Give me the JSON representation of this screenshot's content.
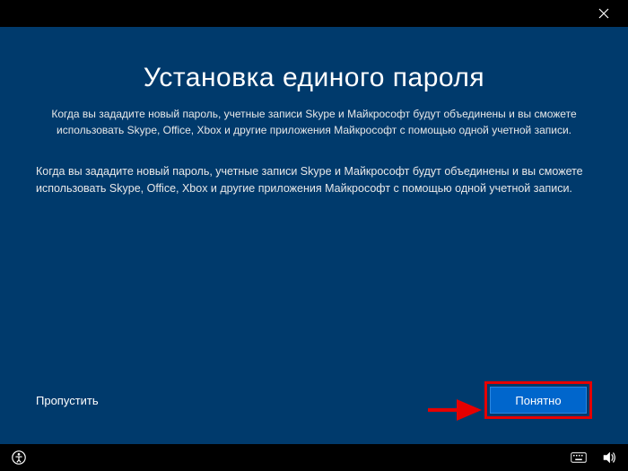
{
  "dialog": {
    "heading": "Установка единого пароля",
    "subheading": "Когда вы зададите новый пароль, учетные записи Skype и Майкрософт будут объединены и вы сможете использовать Skype, Office, Xbox и другие приложения Майкрософт с помощью одной учетной записи.",
    "body": "Когда вы зададите новый пароль, учетные записи Skype и Майкрософт будут объединены и вы сможете использовать Skype, Office, Xbox и другие приложения Майкрософт с помощью одной учетной записи.",
    "skip_label": "Пропустить",
    "primary_label": "Понятно"
  },
  "colors": {
    "bg": "#003a6c",
    "primary_button": "#0066cc",
    "annotation": "#e60000"
  }
}
